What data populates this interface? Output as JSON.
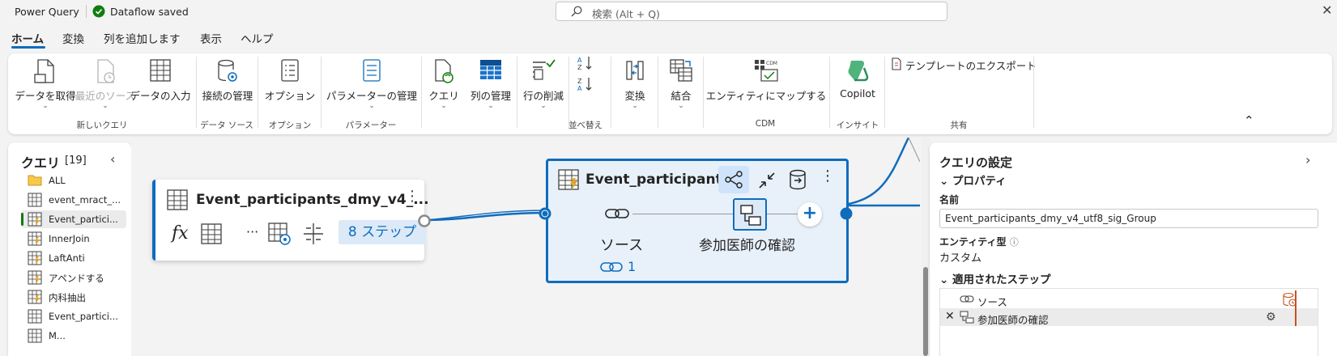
{
  "titlebar": {
    "app_title": "Power Query",
    "status": "Dataflow saved",
    "search_placeholder": "検索 (Alt + Q)"
  },
  "tabs": [
    "ホーム",
    "変換",
    "列を追加します",
    "表示",
    "ヘルプ"
  ],
  "ribbon": {
    "get_data": "データを取得",
    "recent_sources": "最近のソース",
    "enter_data": "データの入力",
    "group_new_query": "新しいクエリ",
    "manage_connections": "接続の管理",
    "group_data_source": "データ ソース",
    "options": "オプション",
    "group_options": "オプション",
    "manage_parameters": "パラメーターの管理",
    "group_parameters": "パラメーター",
    "query": "クエリ",
    "manage_columns": "列の管理",
    "remove_rows": "行の削減",
    "group_sort": "並べ替え",
    "transform": "変換",
    "combine": "結合",
    "map_to_entity": "エンティティにマップする",
    "group_cdm": "CDM",
    "copilot": "Copilot",
    "group_insight": "インサイト",
    "export_template": "テンプレートのエクスポート",
    "group_share": "共有"
  },
  "queries": {
    "title": "クエリ",
    "count": "[19]",
    "items": [
      {
        "label": "ALL",
        "icon": "folder-icon"
      },
      {
        "label": "event_mract_...",
        "icon": "table-icon"
      },
      {
        "label": "Event_partici...",
        "icon": "query-table-icon",
        "selected": true
      },
      {
        "label": "InnerJoin",
        "icon": "query-table-icon"
      },
      {
        "label": "LaftAnti",
        "icon": "query-table-icon"
      },
      {
        "label": "アペンドする",
        "icon": "query-table-icon"
      },
      {
        "label": "内科抽出",
        "icon": "query-table-icon"
      },
      {
        "label": "Event_partici...",
        "icon": "table-icon"
      },
      {
        "label": "M...",
        "icon": "table-icon"
      }
    ]
  },
  "diagram": {
    "node1": {
      "title": "Event_participants_dmy_v4_...",
      "steps": "8 ステップ"
    },
    "node2": {
      "title": "Event_participants...",
      "source_label": "ソース",
      "step_label": "参加医師の確認",
      "link_count": "1"
    }
  },
  "settings": {
    "title": "クエリの設定",
    "properties": "プロパティ",
    "name_label": "名前",
    "name_value": "Event_participants_dmy_v4_utf8_sig_Group",
    "entity_label": "エンティティ型",
    "entity_value": "カスタム",
    "applied_steps": "適用されたステップ",
    "steps": [
      "ソース",
      "参加医師の確認"
    ]
  },
  "colors": {
    "accent": "#0f6cbd",
    "saved_green": "#107c10",
    "warning_orange": "#c4511f",
    "query_orange": "#e8a317"
  }
}
